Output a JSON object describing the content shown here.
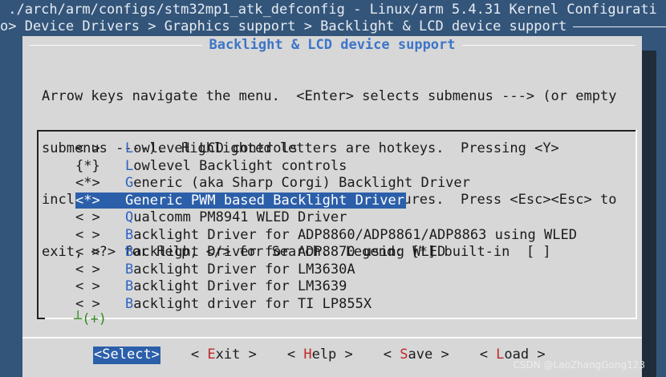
{
  "window": {
    "title": " ./arch/arm/configs/stm32mp1_atk_defconfig - Linux/arm 5.4.31 Kernel Configurati",
    "breadcrumb": "o> Device Drivers > Graphics support > Backlight & LCD device support"
  },
  "dialog": {
    "title": "Backlight & LCD device support",
    "help_lines": [
      "Arrow keys navigate the menu.  <Enter> selects submenus ---> (or empty",
      "submenus ----).  Highlighted letters are hotkeys.  Pressing <Y>",
      "includes, <N> excludes, <M> modularizes features.  Press <Esc><Esc> to",
      "exit, <?> for Help, </> for Search.  Legend: [*] built-in  [ ]"
    ]
  },
  "menu": {
    "items": [
      {
        "marker": "< >",
        "hot": "L",
        "rest": "owlevel LCD controls",
        "indent": false,
        "selected": false
      },
      {
        "marker": "{*}",
        "hot": "L",
        "rest": "owlevel Backlight controls",
        "indent": false,
        "selected": false
      },
      {
        "marker": "<*>",
        "hot": "G",
        "rest": "eneric (aka Sharp Corgi) Backlight Driver",
        "indent": true,
        "selected": false
      },
      {
        "marker": "<*>",
        "hot": "G",
        "rest": "eneric PWM based Backlight Driver",
        "indent": true,
        "selected": true
      },
      {
        "marker": "< >",
        "hot": "Q",
        "rest": "ualcomm PM8941 WLED Driver",
        "indent": true,
        "selected": false
      },
      {
        "marker": "< >",
        "hot": "B",
        "rest": "acklight Driver for ADP8860/ADP8861/ADP8863 using WLED",
        "indent": true,
        "selected": false
      },
      {
        "marker": "< >",
        "hot": "B",
        "rest": "acklight Driver for ADP8870 using WLED",
        "indent": true,
        "selected": false
      },
      {
        "marker": "< >",
        "hot": "B",
        "rest": "acklight Driver for LM3630A",
        "indent": true,
        "selected": false
      },
      {
        "marker": "< >",
        "hot": "B",
        "rest": "acklight Driver for LM3639",
        "indent": true,
        "selected": false
      },
      {
        "marker": "< >",
        "hot": "B",
        "rest": "acklight driver for TI LP855X",
        "indent": true,
        "selected": false
      }
    ],
    "more_indicator": "┴(+)"
  },
  "buttons": {
    "select": {
      "pre": "<",
      "hot": "S",
      "post": "elect>"
    },
    "exit": {
      "pre": "< ",
      "hot": "E",
      "post": "xit >"
    },
    "help": {
      "pre": "< ",
      "hot": "H",
      "post": "elp >"
    },
    "save": {
      "pre": "< ",
      "hot": "S",
      "post": "ave >"
    },
    "load": {
      "pre": "< ",
      "hot": "L",
      "post": "oad >"
    }
  },
  "watermark": "CSDN @LaoZhangGong123",
  "colors": {
    "background": "#34557a",
    "dialog": "#d7d7d7",
    "highlight": "#2c5fa9",
    "hotkey_menu": "#2f63c0",
    "hotkey_button": "#c0282a"
  }
}
